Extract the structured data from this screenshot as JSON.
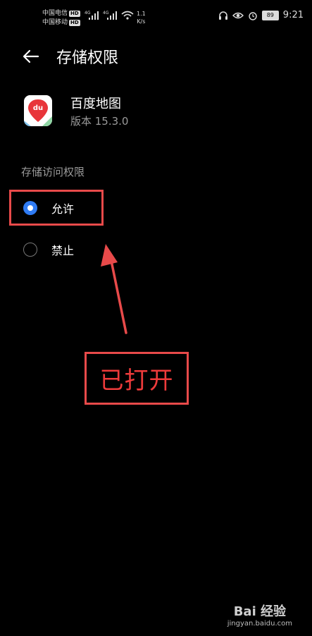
{
  "status_bar": {
    "carrier1": "中国电信",
    "carrier2": "中国移动",
    "hd": "HD",
    "net_type": "4G",
    "speed_value": "1.1",
    "speed_unit": "K/s",
    "battery": "89",
    "time": "9:21"
  },
  "header": {
    "title": "存储权限"
  },
  "app": {
    "name": "百度地图",
    "version": "版本 15.3.0",
    "icon_text": "du"
  },
  "section": {
    "label": "存储访问权限"
  },
  "options": [
    {
      "label": "允许",
      "selected": true
    },
    {
      "label": "禁止",
      "selected": false
    }
  ],
  "annotation": {
    "text": "已打开",
    "color": "#e84a4a"
  },
  "watermark": {
    "logo": "Bai 经验",
    "url": "jingyan.baidu.com"
  },
  "colors": {
    "accent": "#2f7bf3",
    "background": "#000000"
  }
}
